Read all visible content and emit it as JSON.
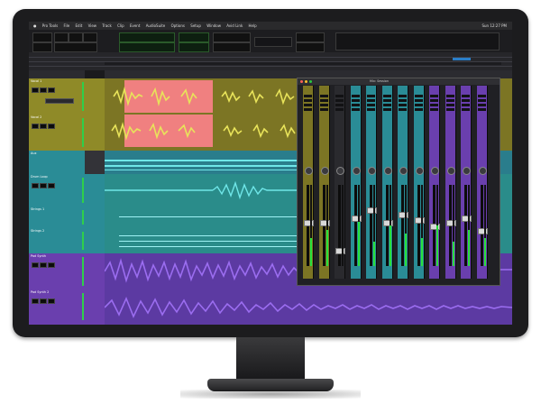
{
  "app": {
    "name": "Pro Tools",
    "menus": [
      "Pro Tools",
      "File",
      "Edit",
      "View",
      "Track",
      "Clip",
      "Event",
      "AudioSuite",
      "Options",
      "Setup",
      "Window",
      "Avid Link",
      "Help"
    ],
    "clock": "Sun 12:27 PM"
  },
  "tracks": [
    {
      "name": "Vocal 1",
      "color": "#8f8a28"
    },
    {
      "name": "Vocal 2",
      "color": "#8f8a28"
    },
    {
      "name": "Aux",
      "color": "#2a8c96"
    },
    {
      "name": "Drum Loop",
      "color": "#2a8c96"
    },
    {
      "name": "Strings 1",
      "color": "#2a8c96"
    },
    {
      "name": "Strings 2",
      "color": "#2a8c96"
    },
    {
      "name": "Pad Synth",
      "color": "#6a3fae"
    },
    {
      "name": "Pad Synth 2",
      "color": "#6a3fae"
    }
  ],
  "clip_colors": {
    "vocal_lane": "#7c7524",
    "vocal_highlight": "#f08080",
    "vocal_wave": "#e8e35a",
    "aux_lane": "#2a7d8c",
    "teal_lane": "#2a8c8a",
    "teal_wave": "#6fe6e8",
    "purple_lane": "#5c3aa2",
    "purple_wave": "#9b6df0"
  },
  "mixer": {
    "title": "Mix: Session",
    "strip_colors": [
      "#7c7524",
      "#7c7524",
      "#2a2a2e",
      "#2a8c96",
      "#2a8c96",
      "#2a8c96",
      "#2a8c96",
      "#2a8c96",
      "#6a3fae",
      "#6a3fae",
      "#6a3fae",
      "#6a3fae"
    ],
    "strip_levels": [
      0.55,
      0.55,
      0.2,
      0.6,
      0.7,
      0.55,
      0.65,
      0.58,
      0.5,
      0.55,
      0.6,
      0.45
    ],
    "meter_levels": [
      0.35,
      0.45,
      0.0,
      0.55,
      0.3,
      0.5,
      0.4,
      0.35,
      0.5,
      0.3,
      0.45,
      0.35
    ]
  }
}
